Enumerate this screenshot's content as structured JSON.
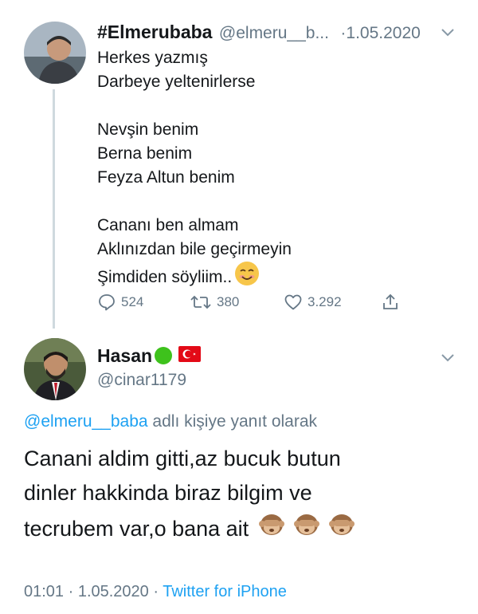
{
  "tweet": {
    "display_name": "#Elmerubaba",
    "handle": "@elmeru__b...",
    "date": "·1.05.2020",
    "lines": [
      "Herkes yazmış",
      "Darbeye yeltenirlerse",
      "",
      "Nevşin benim",
      "Berna benim",
      "Feyza Altun benim",
      "",
      "Cananı ben almam",
      "Aklınızdan bile geçirmeyin",
      "Şimdiden söyliim.."
    ],
    "emoji": "smiling-face-emoji",
    "actions": {
      "replies": "524",
      "retweets": "380",
      "likes": "3.292"
    }
  },
  "reply": {
    "display_name": "Hasan",
    "handle": "@cinar1179",
    "replying_to_handle": "@elmeru__baba",
    "replying_to_suffix": " adlı kişiye yanıt olarak",
    "body_lines": [
      "Canani aldim gitti,az bucuk butun",
      "dinler hakkinda biraz bilgim ve",
      "tecrubem var,o bana ait"
    ],
    "emojis": [
      "see-no-evil-monkey-emoji",
      "see-no-evil-monkey-emoji",
      "see-no-evil-monkey-emoji"
    ],
    "time": "01:01 · 1.05.2020 · ",
    "source": "Twitter for iPhone"
  },
  "colors": {
    "accent": "#1da1f2",
    "muted": "#657786",
    "text": "#14171a",
    "green_badge": "#3ec21c",
    "flag_red": "#e30a17"
  }
}
